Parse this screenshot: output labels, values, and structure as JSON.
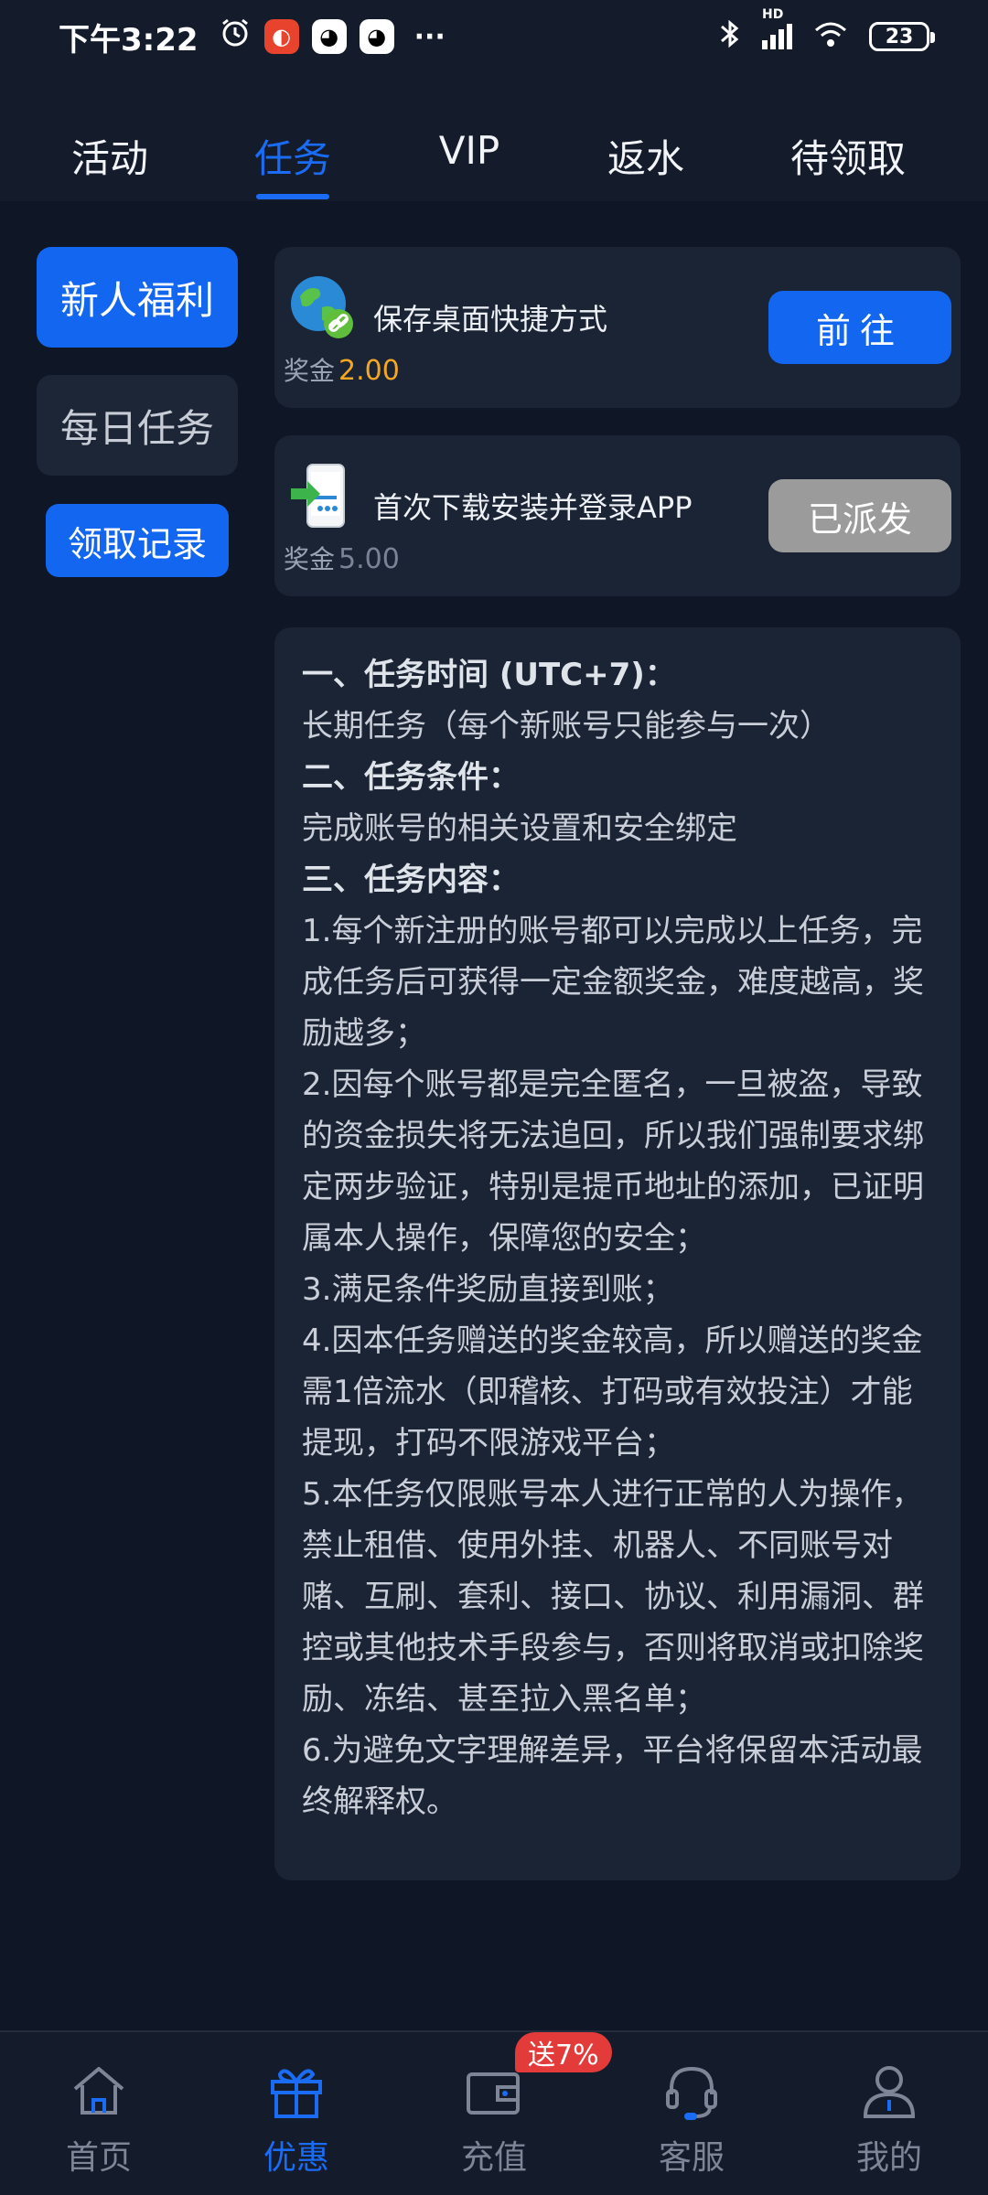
{
  "status_bar": {
    "time": "下午3:22",
    "network": "HD",
    "battery": "23"
  },
  "top_tabs": [
    "活动",
    "任务",
    "VIP",
    "返水",
    "待领取"
  ],
  "active_tab": "任务",
  "left_menu": {
    "newbie": "新人福利",
    "daily": "每日任务",
    "record": "领取记录"
  },
  "tasks": [
    {
      "title": "保存桌面快捷方式",
      "reward_label": "奖金",
      "reward": "2.00",
      "button": "前往"
    },
    {
      "title": "首次下载安装并登录APP",
      "reward_label": "奖金",
      "reward": "5.00",
      "button": "已派发"
    }
  ],
  "rules": [
    "一、任务时间 (UTC+7)：",
    "长期任务（每个新账号只能参与一次）",
    "二、任务条件：",
    "完成账号的相关设置和安全绑定",
    "三、任务内容：",
    "1.每个新注册的账号都可以完成以上任务，完成任务后可获得一定金额奖金，难度越高，奖励越多；",
    "2.因每个账号都是完全匿名，一旦被盗，导致的资金损失将无法追回，所以我们强制要求绑定两步验证，特别是提币地址的添加，已证明属本人操作，保障您的安全；",
    "3.满足条件奖励直接到账；",
    "4.因本任务赠送的奖金较高，所以赠送的奖金需1倍流水（即稽核、打码或有效投注）才能提现，打码不限游戏平台；",
    "5.本任务仅限账号本人进行正常的人为操作，禁止租借、使用外挂、机器人、不同账号对赌、互刷、套利、接口、协议、利用漏洞、群控或其他技术手段参与，否则将取消或扣除奖励、冻结、甚至拉入黑名单；",
    "6.为避免文字理解差异，平台将保留本活动最终解释权。"
  ],
  "bottom_nav": [
    "首页",
    "优惠",
    "充值",
    "客服",
    "我的"
  ],
  "promo_badge": "送7%",
  "colors": {
    "accent": "#1266f0",
    "background": "#0f1726",
    "card": "#1b2434",
    "reward_gold": "#f5a623",
    "badge_red": "#e33a3a"
  }
}
